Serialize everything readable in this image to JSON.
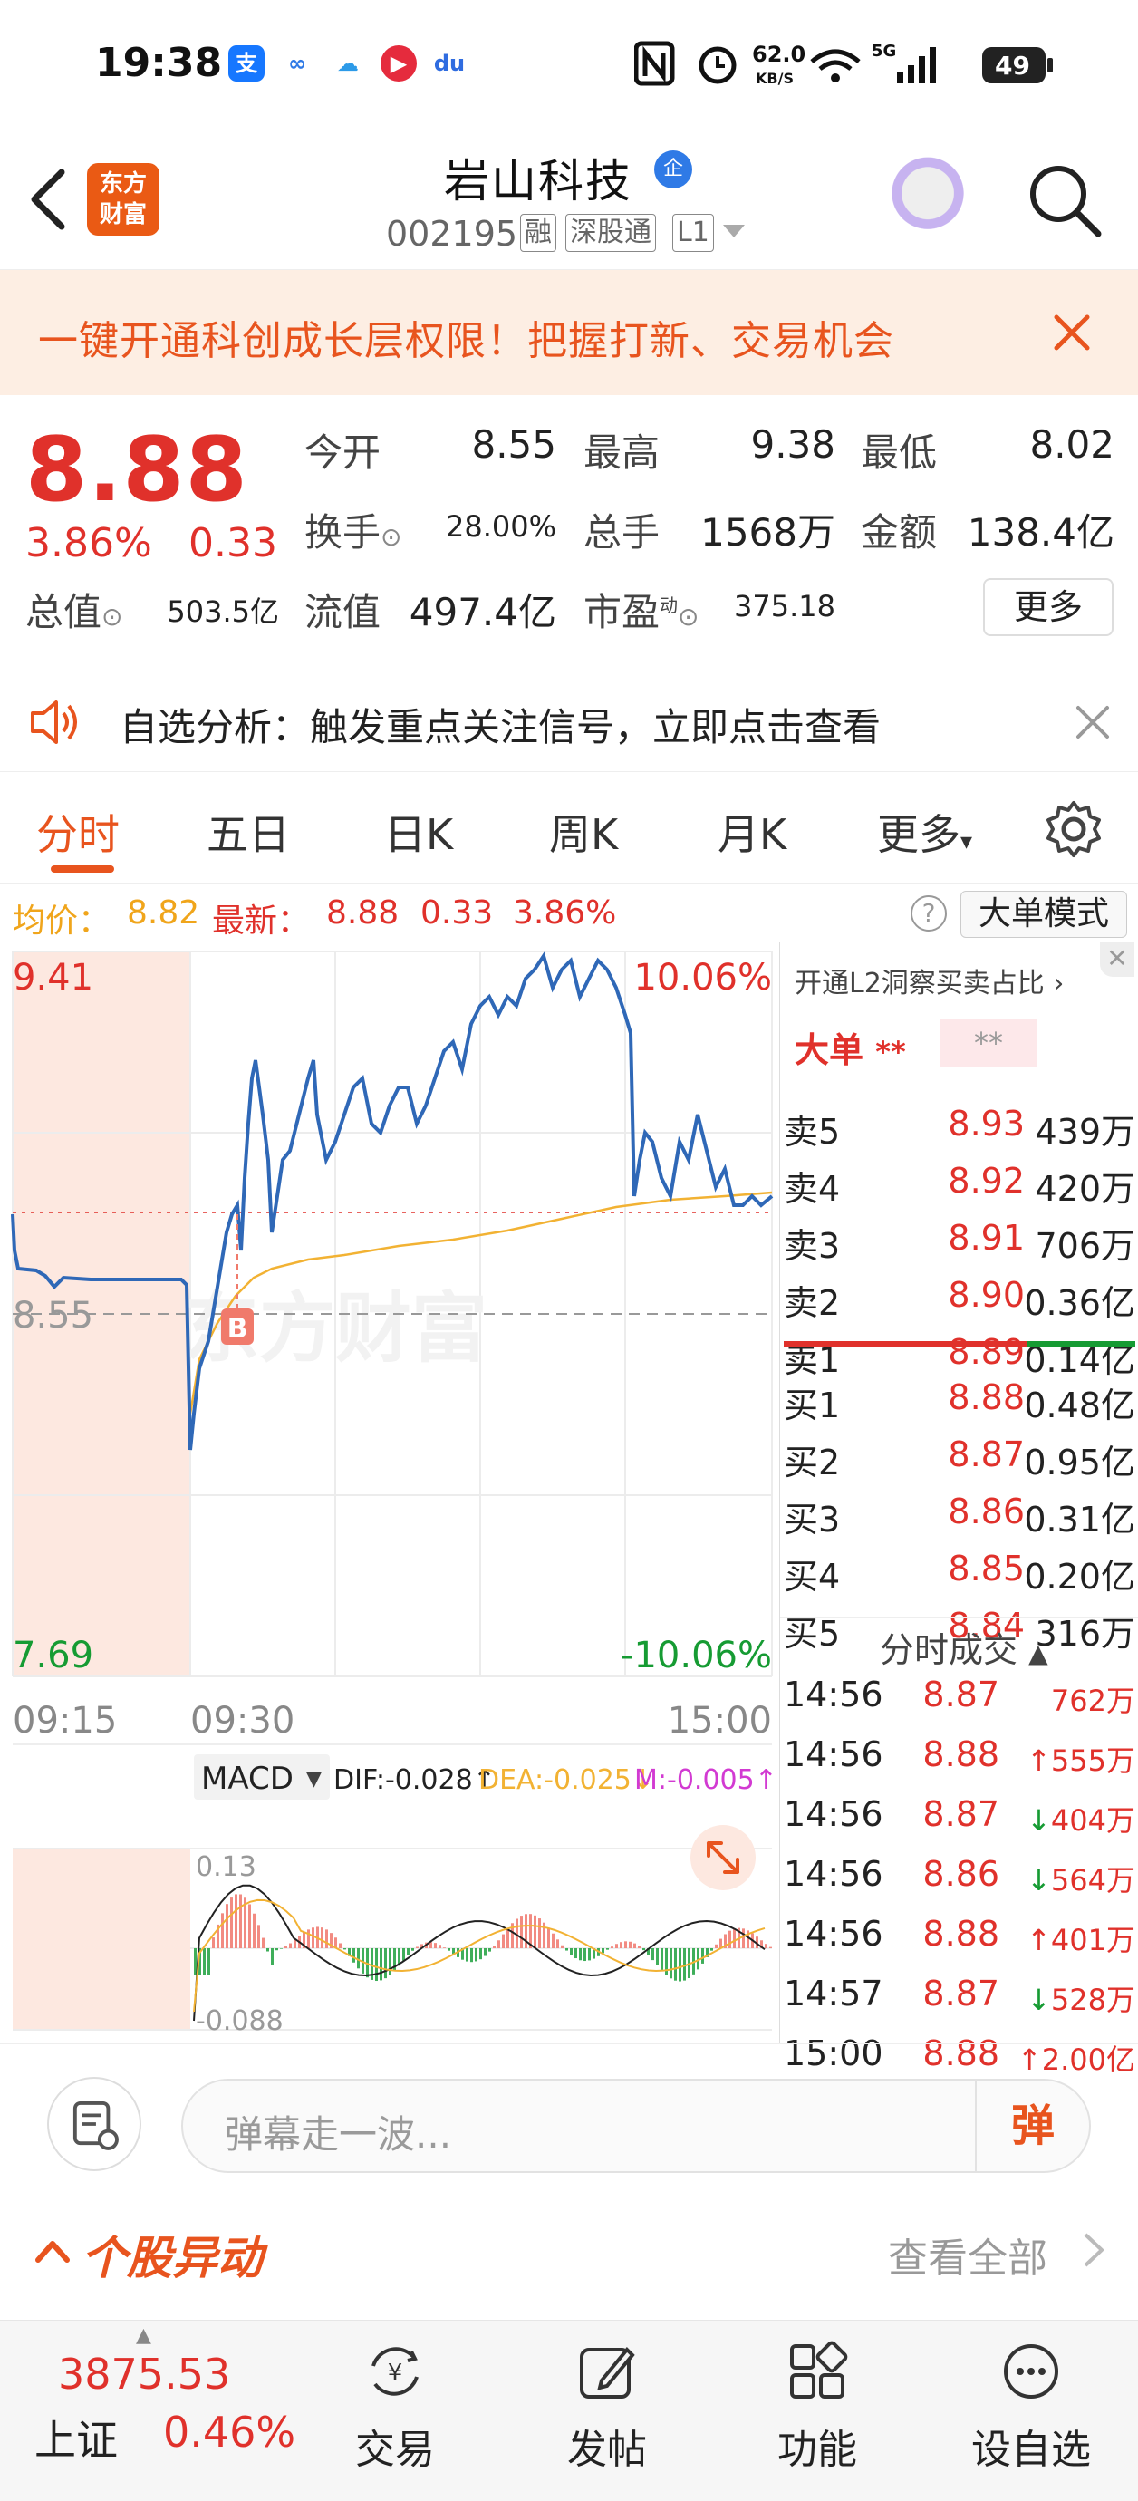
{
  "status_bar": {
    "time": "19:38",
    "network_speed": "62.0",
    "speed_unit": "KB/S",
    "battery": "49",
    "signal": "5G"
  },
  "header": {
    "stock_name": "岩山科技",
    "enterprise_badge": "企",
    "code": "002195",
    "tags": [
      "融",
      "深股通",
      "L1"
    ],
    "logo_line1": "东方",
    "logo_line2": "财富"
  },
  "banner": {
    "text": "一键开通科创成长层权限！把握打新、交易机会"
  },
  "quote": {
    "price": "8.88",
    "change_pct": "3.86%",
    "change_amt": "0.33",
    "open_label": "今开",
    "open": "8.55",
    "high_label": "最高",
    "high": "9.38",
    "low_label": "最低",
    "low": "8.02",
    "turnover_label": "换手",
    "turnover": "28.00%",
    "volume_label": "总手",
    "volume": "1568万",
    "amount_label": "金额",
    "amount": "138.4亿",
    "mktcap_label": "总值",
    "mktcap": "503.5亿",
    "float_label": "流值",
    "float": "497.4亿",
    "pe_label": "市盈",
    "pe_sup": "动",
    "pe": "375.18",
    "more": "更多"
  },
  "alert": {
    "text": "自选分析：触发重点关注信号，立即点击查看"
  },
  "tabs": [
    "分时",
    "五日",
    "日K",
    "周K",
    "月K",
    "更多"
  ],
  "avg_bar": {
    "avg_label": "均价：",
    "avg": "8.82",
    "latest_label": "最新：",
    "latest": "8.88",
    "chg": "0.33",
    "pct": "3.86%",
    "big_order": "大单模式"
  },
  "chart": {
    "top_price": "9.41",
    "bottom_price": "7.69",
    "top_pct": "10.06%",
    "bottom_pct": "-10.06%",
    "ref_price": "8.55",
    "time_start": "09:15",
    "time_open": "09:30",
    "time_end": "15:00",
    "marker": "B",
    "watermark": "东方财富"
  },
  "macd": {
    "name": "MACD",
    "dif": "DIF:-0.028↑",
    "dea": "DEA:-0.025↓",
    "m": "M:-0.005↑",
    "top": "0.13",
    "bottom": "-0.088"
  },
  "l2": {
    "title": "开通L2洞察买卖占比",
    "big_label": "大单",
    "big_val1": "**",
    "big_val2": "**"
  },
  "asks": [
    {
      "label": "卖5",
      "price": "8.93",
      "vol": "439万"
    },
    {
      "label": "卖4",
      "price": "8.92",
      "vol": "420万"
    },
    {
      "label": "卖3",
      "price": "8.91",
      "vol": "706万"
    },
    {
      "label": "卖2",
      "price": "8.90",
      "vol": "0.36亿"
    },
    {
      "label": "卖1",
      "price": "8.89",
      "vol": "0.14亿"
    }
  ],
  "bids": [
    {
      "label": "买1",
      "price": "8.88",
      "vol": "0.48亿"
    },
    {
      "label": "买2",
      "price": "8.87",
      "vol": "0.95亿"
    },
    {
      "label": "买3",
      "price": "8.86",
      "vol": "0.31亿"
    },
    {
      "label": "买4",
      "price": "8.85",
      "vol": "0.20亿"
    },
    {
      "label": "买5",
      "price": "8.84",
      "vol": "316万"
    }
  ],
  "trades_title": "分时成交",
  "trades": [
    {
      "time": "14:56",
      "price": "8.87",
      "vol": "762万",
      "dir": "",
      "color": "red"
    },
    {
      "time": "14:56",
      "price": "8.88",
      "vol": "555万",
      "dir": "↑",
      "color": "red"
    },
    {
      "time": "14:56",
      "price": "8.87",
      "vol": "404万",
      "dir": "↓",
      "color": "green"
    },
    {
      "time": "14:56",
      "price": "8.86",
      "vol": "564万",
      "dir": "↓",
      "color": "green"
    },
    {
      "time": "14:56",
      "price": "8.88",
      "vol": "401万",
      "dir": "↑",
      "color": "red"
    },
    {
      "time": "14:57",
      "price": "8.87",
      "vol": "528万",
      "dir": "↓",
      "color": "green"
    },
    {
      "time": "15:00",
      "price": "8.88",
      "vol": "2.00亿",
      "dir": "↑",
      "color": "red"
    }
  ],
  "comment": {
    "placeholder": "弹幕走一波...",
    "danmu": "弹"
  },
  "movement": {
    "title": "个股异动",
    "view_all": "查看全部"
  },
  "bottom_nav": {
    "index_value": "3875.53",
    "index_name": "上证",
    "index_pct": "0.46%",
    "items": [
      "交易",
      "发帖",
      "功能",
      "设自选"
    ]
  },
  "colors": {
    "accent": "#e8541e",
    "up": "#e0312b",
    "down": "#169b33",
    "price_line": "#2f68b7",
    "avg_line": "#f2b233"
  }
}
